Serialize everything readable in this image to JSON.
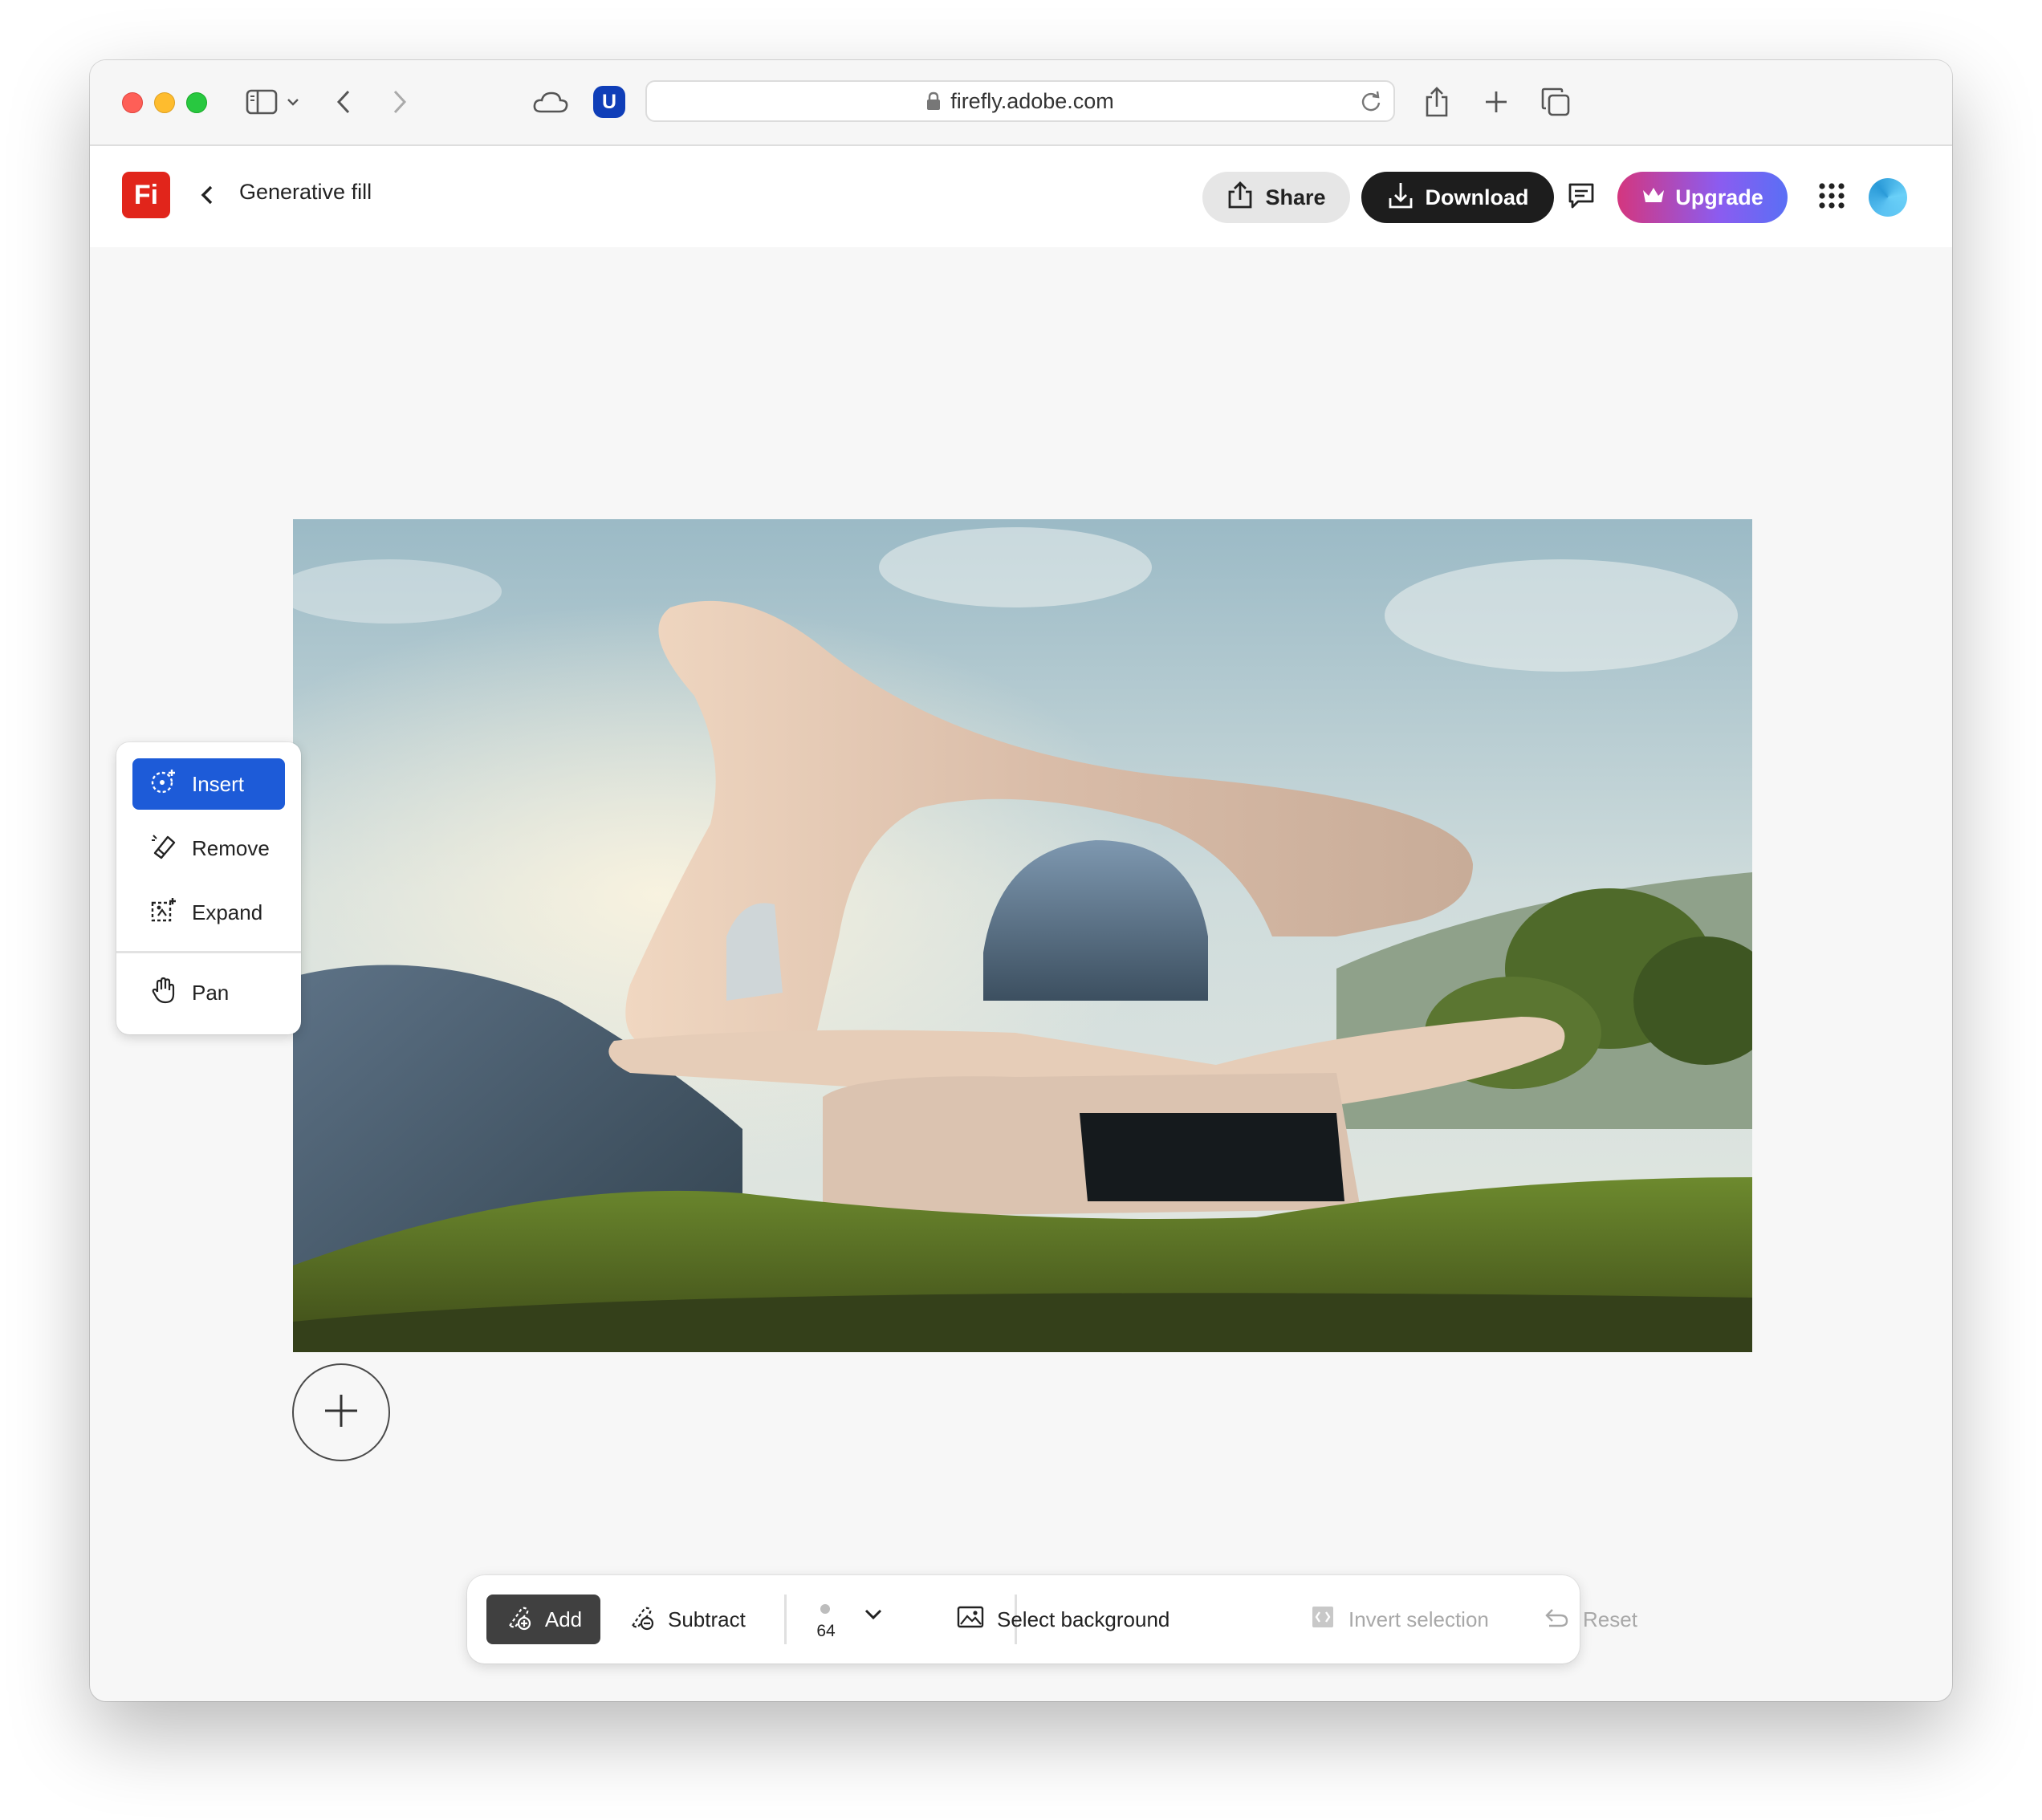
{
  "browser": {
    "url": "firefly.adobe.com",
    "extension_badge": "U"
  },
  "header": {
    "logo_text": "Fi",
    "title": "Generative fill",
    "share_label": "Share",
    "download_label": "Download",
    "upgrade_label": "Upgrade"
  },
  "tools": {
    "items": [
      {
        "label": "Insert",
        "icon": "insert-icon",
        "active": true
      },
      {
        "label": "Remove",
        "icon": "eraser-icon",
        "active": false
      },
      {
        "label": "Expand",
        "icon": "expand-icon",
        "active": false
      },
      {
        "label": "Pan",
        "icon": "hand-icon",
        "active": false
      }
    ]
  },
  "canvas": {
    "image_subject": "Curved futuristic house on a green hillside"
  },
  "toolbar": {
    "add_label": "Add",
    "subtract_label": "Subtract",
    "brush_size": "64",
    "select_background_label": "Select background",
    "invert_selection_label": "Invert selection",
    "reset_label": "Reset"
  },
  "colors": {
    "accent": "#1d5bd8",
    "brand_red": "#e1251b",
    "upgrade_gradient_start": "#d4367e",
    "upgrade_gradient_end": "#5a6ff5"
  }
}
